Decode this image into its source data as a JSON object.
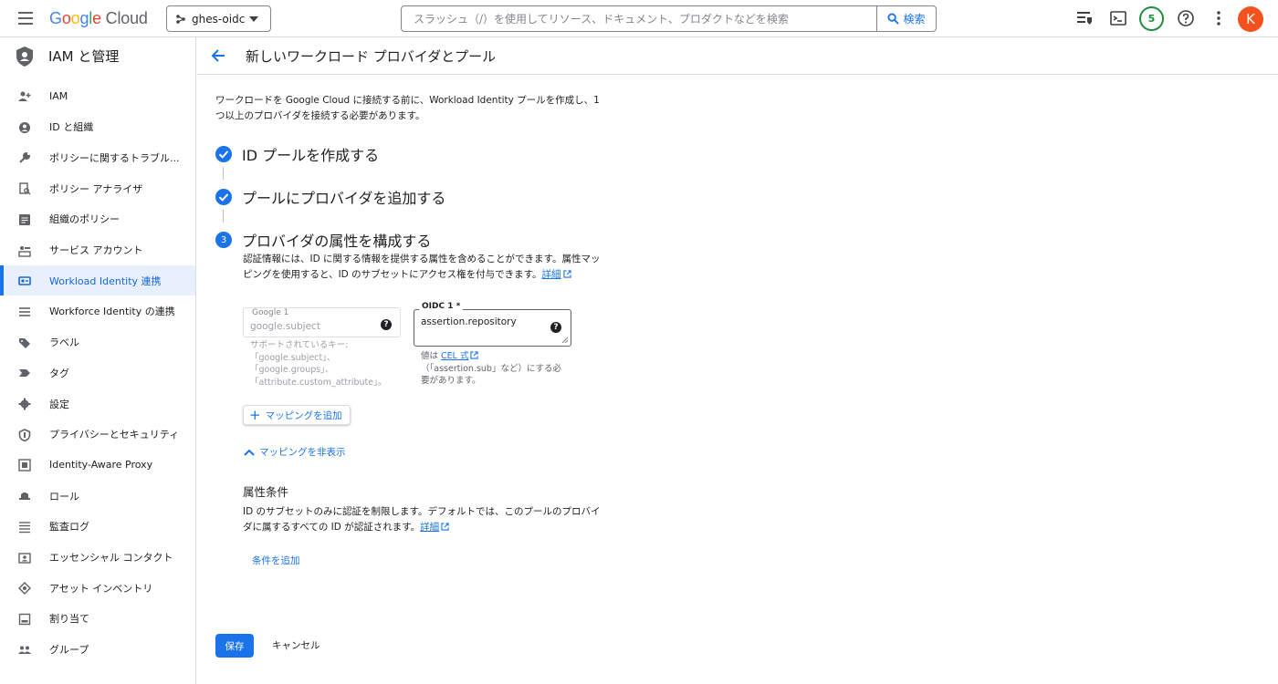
{
  "topbar": {
    "logo": {
      "g": "G",
      "o1": "o",
      "o2": "o",
      "g2": "g",
      "l": "l",
      "e": "e",
      "cloud": " Cloud"
    },
    "project": "ghes-oidc",
    "search_placeholder": "スラッシュ（/）を使用してリソース、ドキュメント、プロダクトなどを検索",
    "search_button": "検索",
    "notification_count": "5",
    "avatar_letter": "K"
  },
  "sidebar": {
    "title": "IAM と管理",
    "items": [
      {
        "label": "IAM",
        "icon": "person-add-icon"
      },
      {
        "label": "ID と組織",
        "icon": "account-circle-icon"
      },
      {
        "label": "ポリシーに関するトラブル...",
        "icon": "wrench-icon"
      },
      {
        "label": "ポリシー アナライザ",
        "icon": "policy-analyzer-icon"
      },
      {
        "label": "組織のポリシー",
        "icon": "article-icon"
      },
      {
        "label": "サービス アカウント",
        "icon": "service-account-icon"
      },
      {
        "label": "Workload Identity 連携",
        "icon": "workload-identity-icon"
      },
      {
        "label": "Workforce Identity の連携",
        "icon": "list-icon"
      },
      {
        "label": "ラベル",
        "icon": "label-icon"
      },
      {
        "label": "タグ",
        "icon": "tag-icon"
      },
      {
        "label": "設定",
        "icon": "gear-icon"
      },
      {
        "label": "プライバシーとセキュリティ",
        "icon": "shield-icon"
      },
      {
        "label": "Identity-Aware Proxy",
        "icon": "iap-icon"
      },
      {
        "label": "ロール",
        "icon": "hat-icon"
      },
      {
        "label": "監査ログ",
        "icon": "lines-icon"
      },
      {
        "label": "エッセンシャル コンタクト",
        "icon": "contact-icon"
      },
      {
        "label": "アセット インベントリ",
        "icon": "diamond-icon"
      },
      {
        "label": "割り当て",
        "icon": "quota-icon"
      },
      {
        "label": "グループ",
        "icon": "group-icon"
      }
    ],
    "active_index": 6
  },
  "header": {
    "title": "新しいワークロード プロバイダとプール"
  },
  "main": {
    "intro": "ワークロードを Google Cloud に接続する前に、Workload Identity プールを作成し、1 つ以上のプロバイダを接続する必要があります。",
    "steps": [
      {
        "label": "ID プールを作成する",
        "state": "done"
      },
      {
        "label": "プールにプロバイダを追加する",
        "state": "done"
      },
      {
        "label": "プロバイダの属性を構成する",
        "state": "current",
        "num": "3"
      }
    ],
    "attr_desc": "認証情報には、ID に関する情報を提供する属性を含めることができます。属性マッピングを使用すると、ID のサブセットにアクセス権を付与できます。",
    "learn_more": "詳細",
    "google_field": {
      "label": "Google 1",
      "value": "google.subject",
      "help": "?"
    },
    "google_hint": "サポートされているキー: 「google.subject」、「google.groups」、「attribute.custom_attribute」。",
    "oidc_field": {
      "label": "OIDC 1 *",
      "value": "assertion.repository",
      "help": "?"
    },
    "oidc_hint_prefix": "値は ",
    "oidc_hint_link": "CEL 式",
    "oidc_hint_suffix": "（「assertion.sub」など）にする必要があります。",
    "add_mapping": "マッピングを追加",
    "hide_mapping": "マッピングを非表示",
    "condition_title": "属性条件",
    "condition_desc": "ID のサブセットのみに認証を制限します。デフォルトでは、このプールのプロバイダに属するすべての ID が認証されます。",
    "add_condition": "条件を追加"
  },
  "footer": {
    "save": "保存",
    "cancel": "キャンセル"
  },
  "colors": {
    "accent": "#1a73e8",
    "active_bg": "#e8f0fe",
    "avatar": "#f4511e",
    "badge": "#1e8e3e"
  }
}
